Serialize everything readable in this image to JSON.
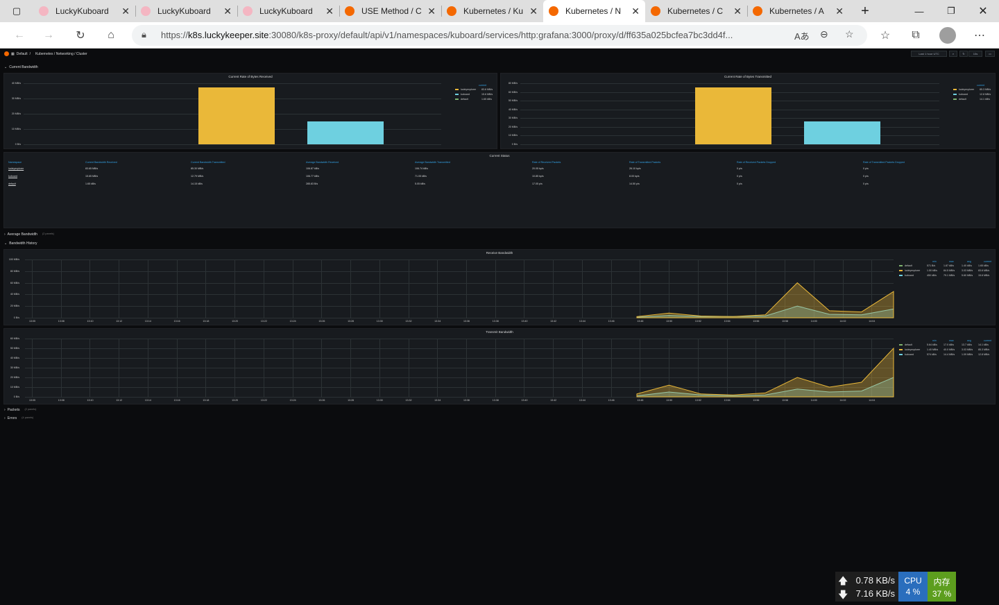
{
  "browser": {
    "tabs": [
      {
        "title": "LuckyKuboard",
        "icon": "sakura-icon",
        "active": false
      },
      {
        "title": "LuckyKuboard",
        "icon": "sakura-icon",
        "active": false
      },
      {
        "title": "LuckyKuboard",
        "icon": "sakura-icon",
        "active": false
      },
      {
        "title": "USE Method / C",
        "icon": "grafana-icon",
        "active": false
      },
      {
        "title": "Kubernetes / Ku",
        "icon": "grafana-icon",
        "active": false
      },
      {
        "title": "Kubernetes / N",
        "icon": "grafana-icon",
        "active": true
      },
      {
        "title": "Kubernetes / C",
        "icon": "grafana-icon",
        "active": false
      },
      {
        "title": "Kubernetes / A",
        "icon": "grafana-icon",
        "active": false
      }
    ],
    "url_prefix": "https://",
    "url_host": "k8s.luckykeeper.site",
    "url_rest": ":30080/k8s-proxy/default/api/v1/namespaces/kuboard/services/http:grafana:3000/proxy/d/ff635a025bcfea7bc3dd4f..."
  },
  "grafana": {
    "breadcrumb": {
      "folder": "Default",
      "sep": "/",
      "dashboard": "Kubernetes / Networking / Cluster"
    },
    "time_picker": "Last 1 hour UTC",
    "refresh": "10s",
    "rows": {
      "current_bandwidth": "Current Bandwidth",
      "average_bandwidth": "Average Bandwidth",
      "average_count": "(2 panels)",
      "bandwidth_history": "Bandwidth History",
      "packets": "Packets",
      "packets_count": "(2 panels)",
      "errors": "Errors",
      "errors_count": "(4 panels)"
    },
    "legend_current": "current",
    "table": {
      "title": "Current Status",
      "headers": [
        "Namespace",
        "Current Bandwidth Received",
        "Current Bandwidth Transmitted",
        "Average Bandwidth Received",
        "Average Bandwidth Transmitted",
        "Rate of Received Packets",
        "Rate of Transmitted Packets",
        "Rate of Received Packets Dropped",
        "Rate of Transmitted Packets Dropped"
      ],
      "rows": [
        [
          "lucleyexplorer",
          "83.65 MB/s",
          "85.30 MB/s",
          "106.87 kB/s",
          "106.74 kB/s",
          "20.05 kp/s",
          "26.10 kp/s",
          "0 p/s",
          "0 p/s"
        ],
        [
          "kuboard",
          "15.65 MB/s",
          "12.79 MB/s",
          "106.77 kB/s",
          "71.05 kB/s",
          "10.85 kp/s",
          "8.00 kp/s",
          "0 p/s",
          "0 p/s"
        ],
        [
          "default",
          "1.65 kB/s",
          "14.15 kB/s",
          "285.83 B/s",
          "5.05 kB/s",
          "17.05 p/s",
          "14.50 p/s",
          "0 p/s",
          "0 p/s"
        ]
      ]
    },
    "history_legend": {
      "headers": [
        "min",
        "max",
        "avg",
        "current"
      ],
      "receive": [
        {
          "name": "default",
          "min": "571 B/s",
          "max": "1.87 kB/s",
          "avg": "1.40 kB/s",
          "current": "1.65 kB/s"
        },
        {
          "name": "lucleyexplorer",
          "min": "1.50 kB/s",
          "max": "84.5 MB/s",
          "avg": "3.03 MB/s",
          "current": "83.6 MB/s"
        },
        {
          "name": "kuboard",
          "min": "450 kB/s",
          "max": "79.1 MB/s",
          "avg": "5.60 MB/s",
          "current": "15.6 MB/s"
        }
      ],
      "transmit": [
        {
          "name": "default",
          "min": "5.64 kB/s",
          "max": "17.0 kB/s",
          "avg": "13.7 kB/s",
          "current": "14.1 kB/s"
        },
        {
          "name": "lucleyexplorer",
          "min": "1.40 MB/s",
          "max": "40.0 MB/s",
          "avg": "3.03 MB/s",
          "current": "85.3 MB/s"
        },
        {
          "name": "kuboard",
          "min": "574 kB/s",
          "max": "14.4 MB/s",
          "avg": "1.09 MB/s",
          "current": "12.8 MB/s"
        }
      ]
    },
    "x_ticks": [
      "13:05",
      "13:08",
      "13:10",
      "13:12",
      "13:14",
      "13:16",
      "13:18",
      "13:20",
      "13:22",
      "13:24",
      "13:26",
      "13:28",
      "13:30",
      "13:32",
      "13:34",
      "13:36",
      "13:38",
      "13:40",
      "13:42",
      "13:44",
      "13:46",
      "13:48",
      "13:50",
      "13:52",
      "13:54",
      "13:56",
      "13:58",
      "14:00",
      "14:02",
      "14:04"
    ],
    "colors": {
      "series1": "#eab839",
      "series2": "#6ed0e0",
      "series3": "#7eb26d"
    }
  },
  "chart_data": [
    {
      "type": "bar",
      "title": "Current Rate of Bytes Received",
      "categories": [
        "lucleyexplorer",
        "kuboard",
        "default"
      ],
      "values": [
        83.6,
        15.6,
        0.00165
      ],
      "ylabel": "MB/s",
      "y_ticks": [
        "40 MB/s",
        "30 MB/s",
        "20 MB/s",
        "10 MB/s",
        "0 B/s"
      ],
      "ylim": [
        0,
        40
      ],
      "legend_values": [
        "83.6 MB/s",
        "15.6 MB/s",
        "1.65 kB/s"
      ]
    },
    {
      "type": "bar",
      "title": "Current Rate of Bytes Transmitted",
      "categories": [
        "lucleyexplorer",
        "kuboard",
        "default"
      ],
      "values": [
        85.3,
        12.8,
        0.0141
      ],
      "ylabel": "MB/s",
      "y_ticks": [
        "80 MB/s",
        "60 MB/s",
        "50 MB/s",
        "40 MB/s",
        "30 MB/s",
        "20 MB/s",
        "10 MB/s",
        "0 B/s"
      ],
      "ylim": [
        0,
        80
      ],
      "legend_values": [
        "85.3 MB/s",
        "12.8 MB/s",
        "14.1 kB/s"
      ]
    },
    {
      "type": "area",
      "title": "Receive Bandwidth",
      "y_ticks": [
        "100 MB/s",
        "80 MB/s",
        "60 MB/s",
        "40 MB/s",
        "20 MB/s",
        "0 B/s"
      ],
      "ylim": [
        0,
        100
      ],
      "x": [
        "13:48",
        "13:50",
        "13:52",
        "13:54",
        "13:56",
        "13:58",
        "14:00",
        "14:02",
        "14:04"
      ],
      "series": [
        {
          "name": "default",
          "values": [
            0,
            0,
            0,
            0,
            0,
            0,
            0,
            0,
            0
          ]
        },
        {
          "name": "lucleyexplorer",
          "values": [
            2,
            8,
            3,
            2,
            5,
            60,
            12,
            10,
            45
          ]
        },
        {
          "name": "kuboard",
          "values": [
            1,
            4,
            2,
            2,
            3,
            20,
            6,
            5,
            15
          ]
        }
      ]
    },
    {
      "type": "area",
      "title": "Transmit Bandwidth",
      "y_ticks": [
        "60 MB/s",
        "50 MB/s",
        "40 MB/s",
        "30 MB/s",
        "20 MB/s",
        "10 MB/s",
        "0 B/s"
      ],
      "ylim": [
        0,
        60
      ],
      "x": [
        "13:48",
        "13:50",
        "13:52",
        "13:54",
        "13:56",
        "13:58",
        "14:00",
        "14:02",
        "14:04"
      ],
      "series": [
        {
          "name": "default",
          "values": [
            0,
            0,
            0,
            0,
            0,
            0,
            0,
            0,
            0
          ]
        },
        {
          "name": "lucleyexplorer",
          "values": [
            3,
            12,
            3,
            2,
            4,
            20,
            10,
            15,
            50
          ]
        },
        {
          "name": "kuboard",
          "values": [
            1,
            5,
            2,
            1,
            2,
            8,
            5,
            6,
            20
          ]
        }
      ]
    }
  ],
  "tray": {
    "up": "0.78 KB/s",
    "down": "7.16 KB/s",
    "cpu_label": "CPU",
    "cpu_value": "4 %",
    "mem_label": "内存",
    "mem_value": "37 %"
  }
}
